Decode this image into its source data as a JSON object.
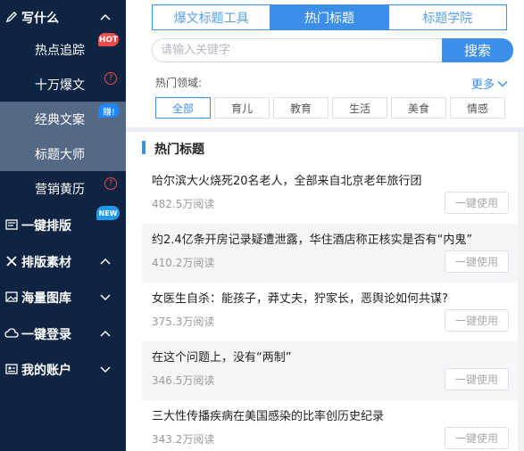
{
  "sidebar": {
    "sections": [
      {
        "label": "写什么",
        "icon": "pen-icon"
      },
      {
        "label": "一键排版",
        "icon": "layout-icon",
        "badge": "NEW"
      },
      {
        "label": "排版素材",
        "icon": "tools-icon"
      },
      {
        "label": "海量图库",
        "icon": "image-icon"
      },
      {
        "label": "一键登录",
        "icon": "cloud-icon"
      },
      {
        "label": "我的账户",
        "icon": "account-icon"
      }
    ],
    "items": [
      {
        "label": "热点追踪",
        "badge": "HOT"
      },
      {
        "label": "十万爆文",
        "badge": "?"
      },
      {
        "label": "经典文案",
        "badge": "赚!"
      },
      {
        "label": "标题大师"
      },
      {
        "label": "营销黄历",
        "badge": "?"
      }
    ]
  },
  "tabs": [
    {
      "label": "爆文标题工具",
      "active": false
    },
    {
      "label": "热门标题",
      "active": true
    },
    {
      "label": "标题学院",
      "active": false
    }
  ],
  "search": {
    "placeholder": "请输入关键字",
    "button": "搜索"
  },
  "domains": {
    "label": "热门领域:",
    "more": "更多",
    "tags": [
      "全部",
      "育儿",
      "教育",
      "生活",
      "美食",
      "情感"
    ],
    "active_tag": "全部"
  },
  "hot": {
    "section_title": "热门标题",
    "use_label": "一键使用",
    "rows": [
      {
        "title": "哈尔滨大火烧死20名老人，全部来自北京老年旅行团",
        "reads": "482.5万阅读"
      },
      {
        "title": "约2.4亿条开房记录疑遭泄露，华住酒店称正核实是否有“内鬼”",
        "reads": "410.2万阅读"
      },
      {
        "title": "女医生自杀：能孩子，莽丈夫，狞家长，恶舆论如何共谋?",
        "reads": "375.3万阅读"
      },
      {
        "title": "在这个问题上，没有“两制”",
        "reads": "346.5万阅读"
      },
      {
        "title": "三大性传播疾病在美国感染的比率创历史纪录",
        "reads": "343.2万阅读"
      }
    ]
  },
  "colors": {
    "sidebar_bg": "#0e2442",
    "accent": "#3b8fe8",
    "hot_badge": "#ef4c45",
    "active_item": "#556986"
  }
}
